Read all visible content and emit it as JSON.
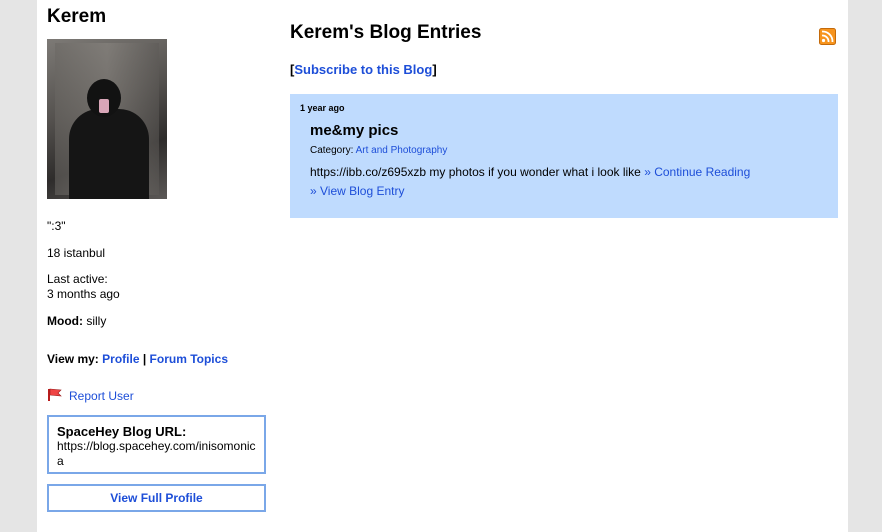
{
  "profile": {
    "name": "Kerem",
    "quote": "\":3\"",
    "age_location": "18 istanbul",
    "last_active_label": "Last active:",
    "last_active_value": "3 months ago",
    "mood_label": "Mood:",
    "mood_value": "silly",
    "view_my_label": "View my:",
    "view_my_profile": "Profile",
    "view_my_separator": "|",
    "view_my_forum": "Forum Topics",
    "report_user": "Report User",
    "blog_url_label": "SpaceHey Blog URL:",
    "blog_url": "https://blog.spacehey.com/inisomonica",
    "view_full_profile": "View Full Profile"
  },
  "blog": {
    "title": "Kerem's Blog Entries",
    "subscribe_prefix": "[",
    "subscribe_label": "Subscribe to this Blog",
    "subscribe_suffix": "]",
    "entries": [
      {
        "time": "1 year ago",
        "title": "me&my pics",
        "category_label": "Category:",
        "category": "Art and Photography",
        "excerpt": "https://ibb.co/z695xzb my photos if you wonder what i look like",
        "continue_label": "» Continue Reading",
        "view_label": "» View Blog Entry"
      }
    ]
  },
  "icons": {
    "rss": "rss-feed-icon",
    "report": "report-flag-icon"
  },
  "colors": {
    "link": "#1d4ed8",
    "entry_bg": "#bfdbfe",
    "box_border": "#7aa7e8",
    "page_bg": "#e5e5e5",
    "rss": "#f7941d"
  }
}
